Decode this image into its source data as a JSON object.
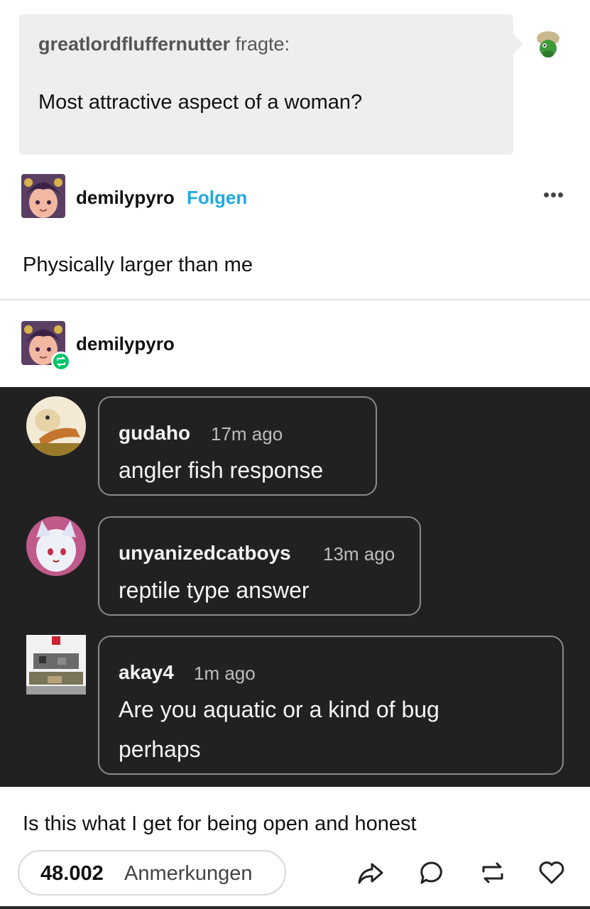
{
  "ask": {
    "asker": "greatlordfluffernutter",
    "verb": "fragte:",
    "question": "Most attractive aspect of a woman?",
    "avatar_icon": "green-dinosaur-avatar"
  },
  "answer_post": {
    "username": "demilypyro",
    "follow_label": "Folgen",
    "more_icon": "ellipsis-icon",
    "text": "Physically larger than me"
  },
  "reblog": {
    "username": "demilypyro",
    "badge_icon": "reblog-icon"
  },
  "comments": [
    {
      "user": "gudaho",
      "time": "17m ago",
      "lines": [
        "angler fish response"
      ]
    },
    {
      "user": "unyanizedcatboys",
      "time": "13m ago",
      "lines": [
        "reptile type answer"
      ]
    },
    {
      "user": "akay4",
      "time": "1m ago",
      "lines": [
        "Are you aquatic or a kind of bug",
        "perhaps"
      ]
    }
  ],
  "closing_text": "Is this what I get for being open and honest",
  "footer": {
    "notes_count": "48.002",
    "notes_label": "Anmerkungen",
    "actions": [
      "share-icon",
      "reply-icon",
      "reblog-icon",
      "like-icon"
    ]
  },
  "colors": {
    "follow": "#1fa9e0",
    "dark_background": "#212121",
    "reblog_badge": "#00c46a"
  }
}
